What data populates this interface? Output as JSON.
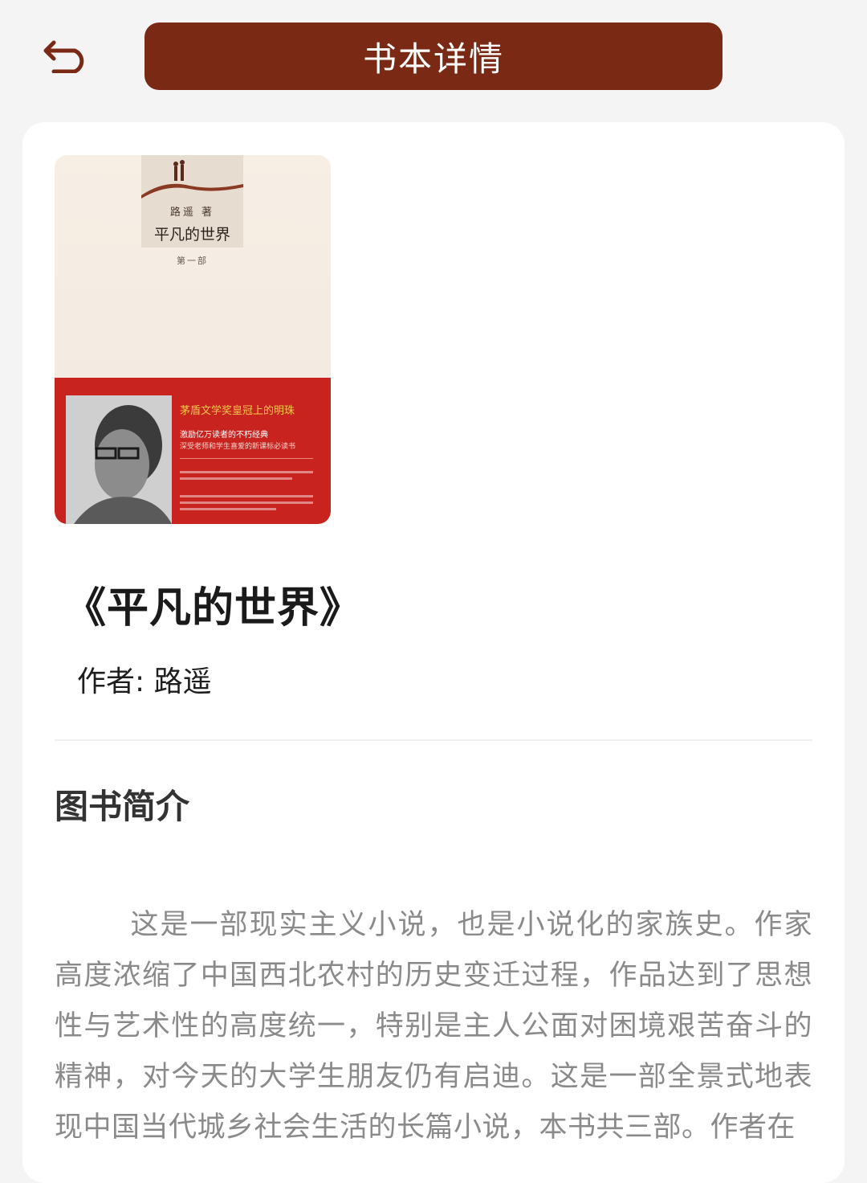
{
  "header": {
    "back_icon": "back-arrow-icon",
    "title": "书本详情",
    "accent_color": "#7a2a14"
  },
  "book": {
    "cover": {
      "author_line": "路遥 著",
      "title": "平凡的世界",
      "volume": "第一部",
      "slogan": "茅盾文学奖皇冠上的明珠",
      "subtitle_1": "激励亿万读者的不朽经典",
      "subtitle_2": "深受老师和学生喜爱的新课标必读书"
    },
    "title": "《平凡的世界》",
    "author": "作者: 路遥"
  },
  "intro": {
    "heading": "图书简介",
    "text": "这是一部现实主义小说，也是小说化的家族史。作家高度浓缩了中国西北农村的历史变迁过程，作品达到了思想性与艺术性的高度统一，特别是主人公面对困境艰苦奋斗的精神，对今天的大学生朋友仍有启迪。这是一部全景式地表现中国当代城乡社会生活的长篇小说，本书共三部。作者在"
  }
}
